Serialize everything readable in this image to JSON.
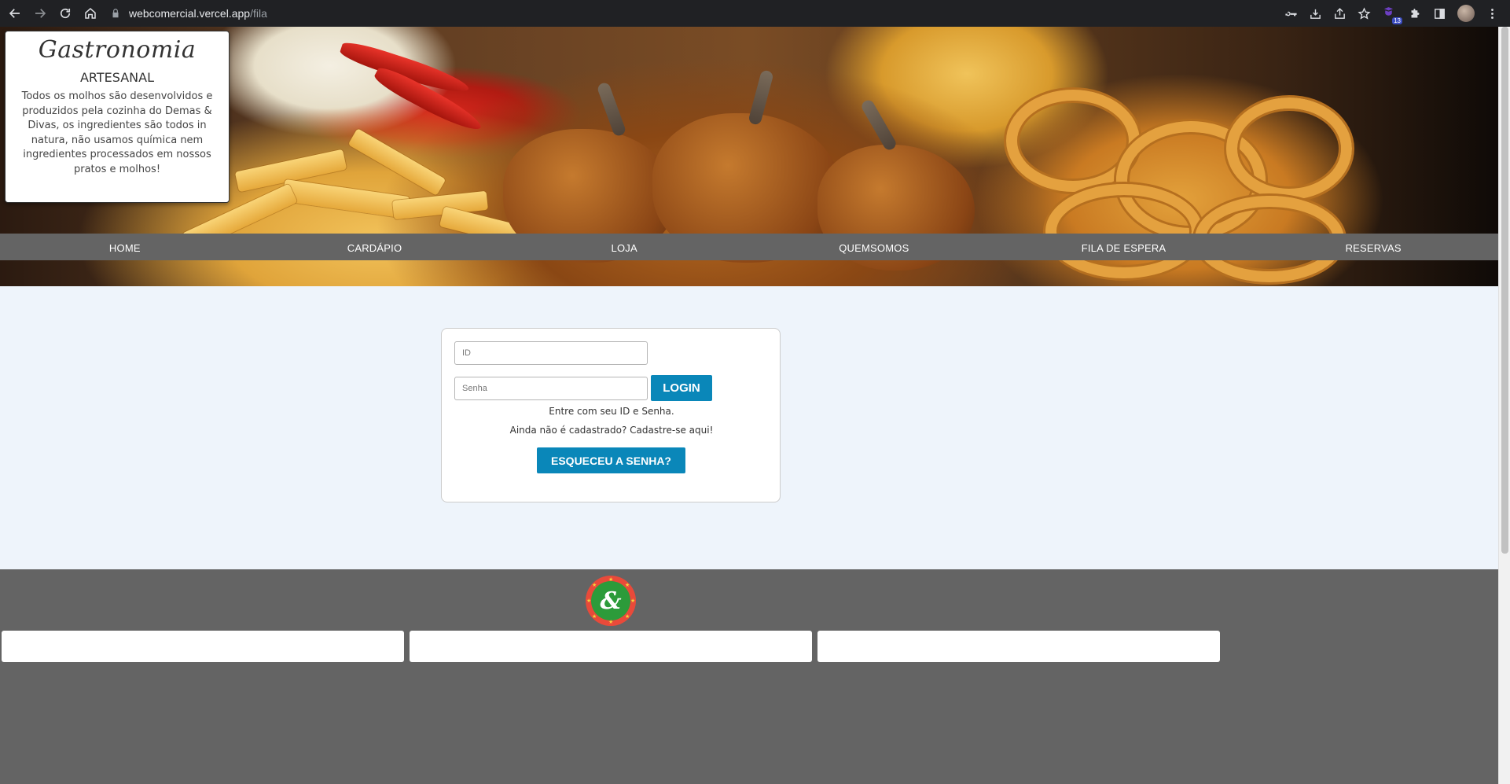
{
  "browser": {
    "url_host": "webcomercial.vercel.app",
    "url_path": "/fila",
    "extension_badge_count": "13"
  },
  "promo": {
    "title": "Gastronomia",
    "subtitle": "ARTESANAL",
    "text": "Todos os molhos são desenvolvidos e produzidos pela cozinha do Demas & Divas, os ingredientes são todos in natura, não usamos química nem ingredientes processados em nossos pratos e molhos!"
  },
  "menu": {
    "items": [
      {
        "label": "HOME"
      },
      {
        "label": "CARDÁPIO"
      },
      {
        "label": "LOJA"
      },
      {
        "label": "QUEMSOMOS"
      },
      {
        "label": "FILA DE ESPERA"
      },
      {
        "label": "RESERVAS"
      }
    ]
  },
  "login": {
    "id_placeholder": "ID",
    "password_placeholder": "Senha",
    "login_button": "LOGIN",
    "message": "Entre com seu ID e Senha.",
    "register_prompt": "Ainda não é cadastrado? Cadastre-se aqui!",
    "forgot_button": "ESQUECEU A SENHA?"
  },
  "footer": {
    "logo_text": "&"
  },
  "colors": {
    "menu_bar": "#646464",
    "primary_button": "#0a87b9",
    "page_background": "#eef4fb",
    "logo_ring": "#e84a3a",
    "logo_center": "#2c9b3a"
  }
}
